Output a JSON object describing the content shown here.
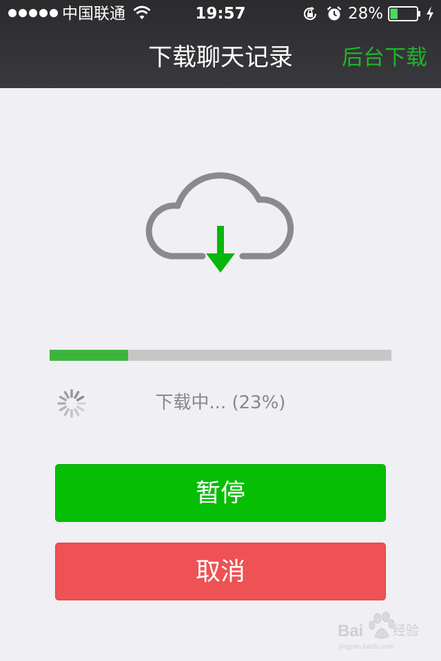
{
  "status_bar": {
    "carrier": "中国联通",
    "time": "19:57",
    "battery_percent": "28%",
    "battery_level": 0.28,
    "icons": [
      "signal-dots",
      "wifi-icon",
      "rotation-lock-icon",
      "alarm-icon",
      "battery-icon",
      "charging-icon"
    ]
  },
  "nav": {
    "title": "下载聊天记录",
    "right_action": "后台下载"
  },
  "download": {
    "icon": "cloud-download-icon",
    "progress": 0.23,
    "status_text": "下载中... (23%)"
  },
  "buttons": {
    "pause": "暂停",
    "cancel": "取消"
  },
  "colors": {
    "header_bg": "#333336",
    "page_bg": "#efeff4",
    "accent_green": "#1db52a",
    "progress_fill": "#3cb43c",
    "progress_track": "#c6c6c6",
    "pause_bg": "#06be04",
    "cancel_bg": "#ee5254",
    "cloud_gray": "#8a8a8a"
  },
  "watermark": {
    "logo_text": "Bai经验",
    "sub_text": "jingyan.baidu.com"
  }
}
